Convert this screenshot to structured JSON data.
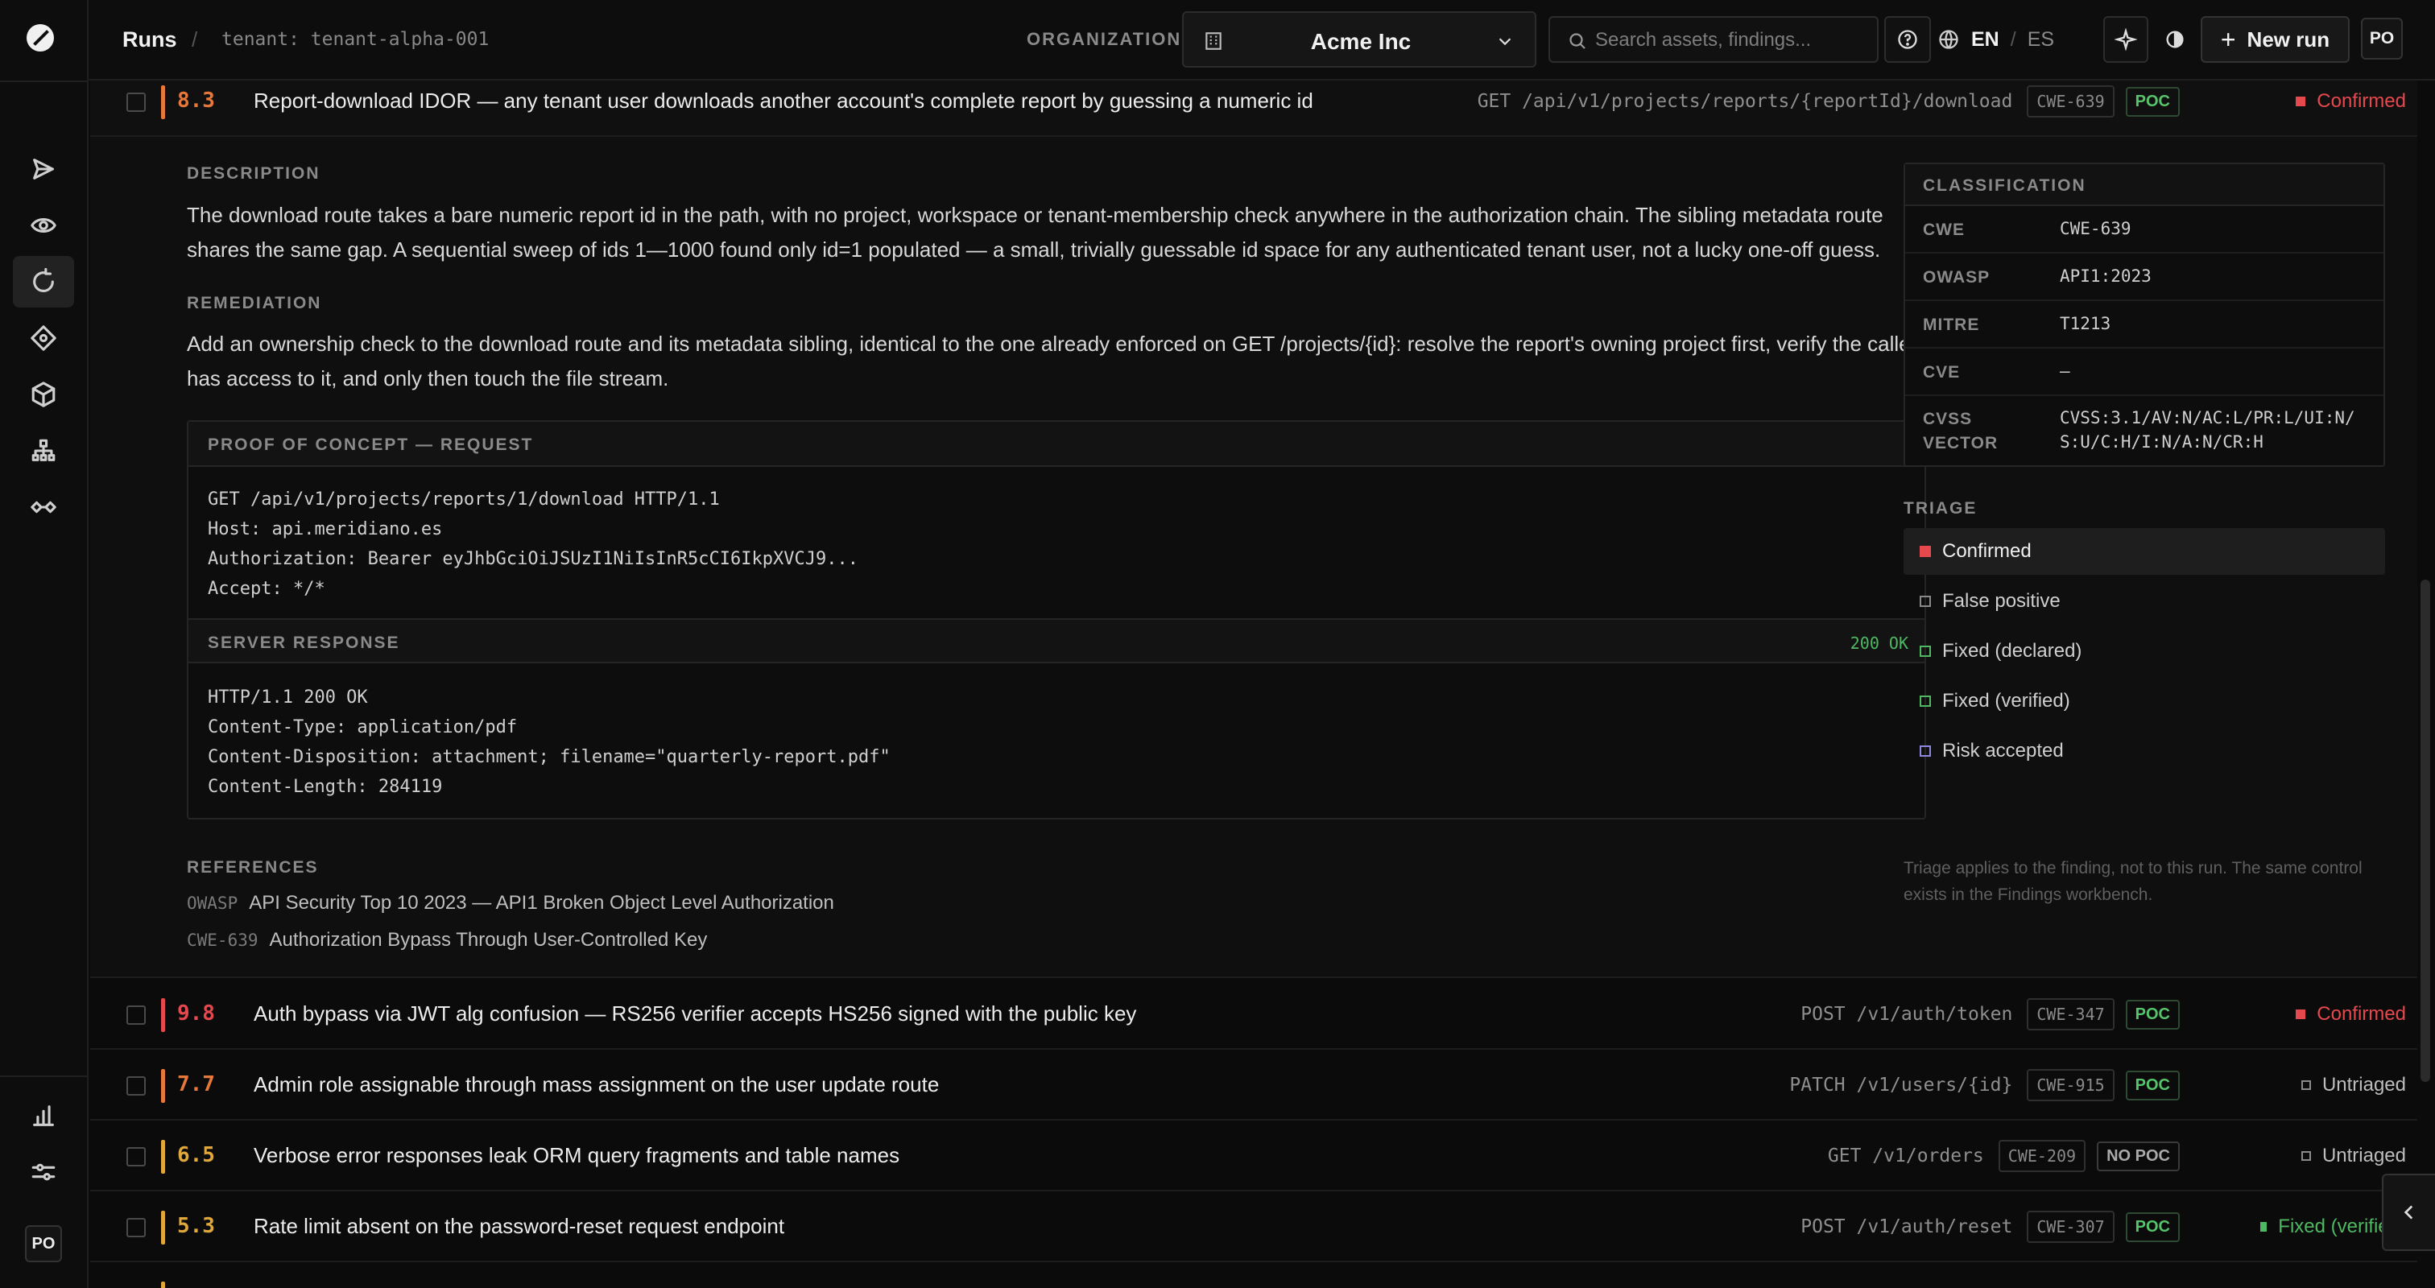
{
  "header": {
    "breadcrumb_runs": "Runs",
    "breadcrumb_sep": "/",
    "breadcrumb_tenant": "tenant: tenant-alpha-001",
    "org_label": "ORGANIZATION",
    "org_value": "Acme Inc",
    "search_placeholder": "Search assets, findings...",
    "lang_en": "EN",
    "lang_sep": "/",
    "lang_es": "ES",
    "new_run_label": "New run",
    "avatar_initials": "PO"
  },
  "sidebar": {
    "nav_icons": [
      "send-icon",
      "eye-icon",
      "refresh-icon",
      "target-icon",
      "cube-icon",
      "hierarchy-icon",
      "link-icon"
    ],
    "active_index": 2,
    "bottom_icons": [
      "bar-chart-icon",
      "sliders-icon"
    ],
    "avatar_initials": "PO"
  },
  "expanded_finding": {
    "score": "8.3",
    "severity_color": "#e8783a",
    "title": "Report-download IDOR — any tenant user downloads another account's complete report by guessing a numeric id",
    "endpoint": "GET /api/v1/projects/reports/{reportId}/download",
    "cwe": "CWE-639",
    "poc": "POC",
    "status": "Confirmed",
    "description_label": "DESCRIPTION",
    "description": "The download route takes a bare numeric report id in the path, with no project, workspace or tenant-membership check anywhere in the authorization chain. The sibling metadata route shares the same gap. A sequential sweep of ids 1—1000 found only id=1 populated — a small, trivially guessable id space for any authenticated tenant user, not a lucky one-off guess.",
    "remediation_label": "REMEDIATION",
    "remediation": "Add an ownership check to the download route and its metadata sibling, identical to the one already enforced on GET /projects/{id}: resolve the report's owning project first, verify the caller has access to it, and only then touch the file stream.",
    "poc_request_label": "PROOF OF CONCEPT — REQUEST",
    "poc_request": "GET /api/v1/projects/reports/1/download HTTP/1.1\nHost: api.meridiano.es\nAuthorization: Bearer eyJhbGciOiJSUzI1NiIsInR5cCI6IkpXVCJ9...\nAccept: */*",
    "server_response_label": "SERVER RESPONSE",
    "server_response_status": "200 OK",
    "server_response": "HTTP/1.1 200 OK\nContent-Type: application/pdf\nContent-Disposition: attachment; filename=\"quarterly-report.pdf\"\nContent-Length: 284119",
    "references_label": "REFERENCES",
    "references": [
      {
        "source": "OWASP",
        "text": "API Security Top 10 2023 — API1 Broken Object Level Authorization"
      },
      {
        "source": "CWE-639",
        "text": "Authorization Bypass Through User-Controlled Key"
      }
    ],
    "classification_label": "CLASSIFICATION",
    "classification": [
      {
        "key": "CWE",
        "value": "CWE-639"
      },
      {
        "key": "OWASP",
        "value": "API1:2023"
      },
      {
        "key": "MITRE",
        "value": "T1213"
      },
      {
        "key": "CVE",
        "value": "—"
      },
      {
        "key": "CVSS\nVECTOR",
        "value": "CVSS:3.1/AV:N/AC:L/PR:L/UI:N/\nS:U/C:H/I:N/A:N/CR:H"
      }
    ],
    "triage_label": "TRIAGE",
    "triage_options": [
      {
        "label": "Confirmed",
        "color": "#e5484d",
        "selected": true
      },
      {
        "label": "False positive",
        "color": "#8a8a8a",
        "selected": false
      },
      {
        "label": "Fixed (declared)",
        "color": "#4fb862",
        "selected": false
      },
      {
        "label": "Fixed (verified)",
        "color": "#4fb862",
        "selected": false
      },
      {
        "label": "Risk accepted",
        "color": "#8f86e0",
        "selected": false
      }
    ],
    "triage_note": "Triage applies to the finding, not to this run. The same control exists in the Findings workbench."
  },
  "findings": [
    {
      "score": "9.8",
      "color": "#e5484d",
      "title": "Auth bypass via JWT alg confusion — RS256 verifier accepts HS256 signed with the public key",
      "endpoint": "POST /v1/auth/token",
      "cwe": "CWE-347",
      "poc": "POC",
      "has_poc": true,
      "status": "Confirmed",
      "status_color": "#e5484d",
      "status_text_color": "#e5484d"
    },
    {
      "score": "7.7",
      "color": "#e8783a",
      "title": "Admin role assignable through mass assignment on the user update route",
      "endpoint": "PATCH /v1/users/{id}",
      "cwe": "CWE-915",
      "poc": "POC",
      "has_poc": true,
      "status": "Untriaged",
      "status_color": "#8a8a8a",
      "status_text_color": "#bdbdbd"
    },
    {
      "score": "6.5",
      "color": "#e0a83a",
      "title": "Verbose error responses leak ORM query fragments and table names",
      "endpoint": "GET /v1/orders",
      "cwe": "CWE-209",
      "poc": "NO POC",
      "has_poc": false,
      "status": "Untriaged",
      "status_color": "#8a8a8a",
      "status_text_color": "#bdbdbd"
    },
    {
      "score": "5.3",
      "color": "#e0a83a",
      "title": "Rate limit absent on the password-reset request endpoint",
      "endpoint": "POST /v1/auth/reset",
      "cwe": "CWE-307",
      "poc": "POC",
      "has_poc": true,
      "status": "Fixed (verified)",
      "status_color": "#4fb862",
      "status_text_color": "#4fb862"
    }
  ]
}
